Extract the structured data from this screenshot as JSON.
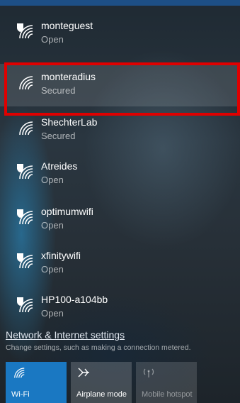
{
  "networks": [
    {
      "name": "monteguest",
      "status": "Open",
      "icon": "wifi-open-icon"
    },
    {
      "name": "monteradius",
      "status": "Secured",
      "icon": "wifi-icon"
    },
    {
      "name": "ShechterLab",
      "status": "Secured",
      "icon": "wifi-icon"
    },
    {
      "name": "Atreides",
      "status": "Open",
      "icon": "wifi-open-icon"
    },
    {
      "name": "optimumwifi",
      "status": "Open",
      "icon": "wifi-open-icon"
    },
    {
      "name": "xfinitywifi",
      "status": "Open",
      "icon": "wifi-open-icon"
    },
    {
      "name": "HP100-a104bb",
      "status": "Open",
      "icon": "wifi-open-icon"
    }
  ],
  "selected_network": "monteradius",
  "settings": {
    "link": "Network & Internet settings",
    "description": "Change settings, such as making a connection metered."
  },
  "quick_actions": {
    "wifi": "Wi-Fi",
    "airplane": "Airplane mode",
    "hotspot": "Mobile hotspot"
  },
  "colors": {
    "accent": "#1a78c2",
    "highlight": "#e00000"
  }
}
